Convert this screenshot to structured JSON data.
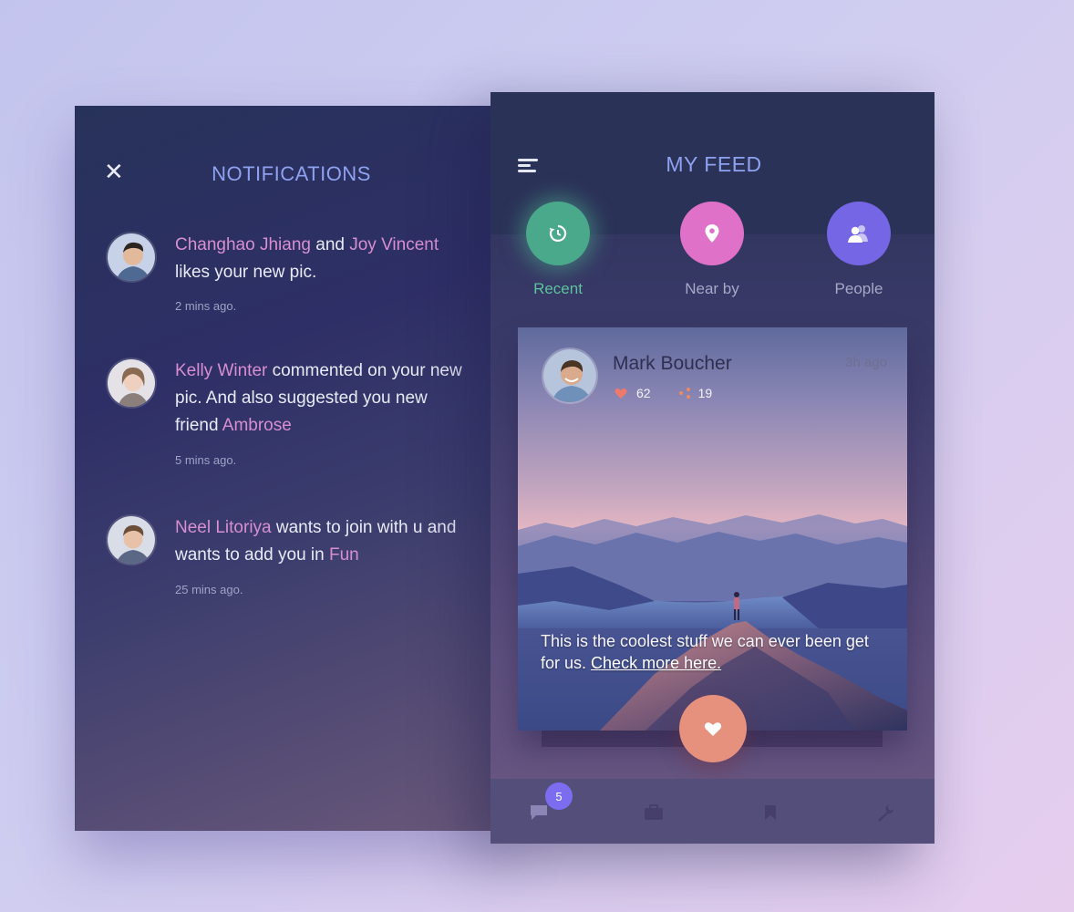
{
  "notifications": {
    "close_icon": "close-icon",
    "title": "NOTIFICATIONS",
    "items": [
      {
        "parts": [
          "Changhao Jhiang",
          " and ",
          "Joy Vincent",
          " likes your new pic."
        ],
        "time": "2 mins ago."
      },
      {
        "parts": [
          "Kelly Winter",
          " commented on your new pic. And also suggested you new friend ",
          "Ambrose"
        ],
        "time": "5 mins ago."
      },
      {
        "parts": [
          "Neel Litoriya",
          " wants to join with u and wants to add you in ",
          "Fun"
        ],
        "time": "25 mins ago."
      }
    ]
  },
  "feed": {
    "title": "MY FEED",
    "menu_icon": "menu-icon",
    "categories": [
      {
        "label": "Recent",
        "icon": "history-icon",
        "color": "#4aa88b",
        "label_color": "#5cc39d"
      },
      {
        "label": "Near by",
        "icon": "location-pin-icon",
        "color": "#e071c9",
        "label_color": "#a7a7c8"
      },
      {
        "label": "People",
        "icon": "people-icon",
        "color": "#7466e4",
        "label_color": "#a7a7c8"
      }
    ],
    "post": {
      "author": "Mark Boucher",
      "time": "3h ago",
      "likes": "62",
      "shares": "19",
      "caption_text": "This is the coolest stuff we can ever been get for us.",
      "caption_link": "Check more here."
    },
    "like_button_icon": "heart-icon",
    "tabbar": {
      "badge_count": "5",
      "tabs": [
        "chat-icon",
        "briefcase-icon",
        "bookmark-icon",
        "wrench-icon"
      ]
    }
  },
  "colors": {
    "accent_title": "#8fa2f0",
    "highlight": "#d78fd1",
    "recent": "#4aa88b",
    "nearby": "#e071c9",
    "people": "#7466e4",
    "like_fab": "#e6907e",
    "badge": "#7b6cf0"
  }
}
